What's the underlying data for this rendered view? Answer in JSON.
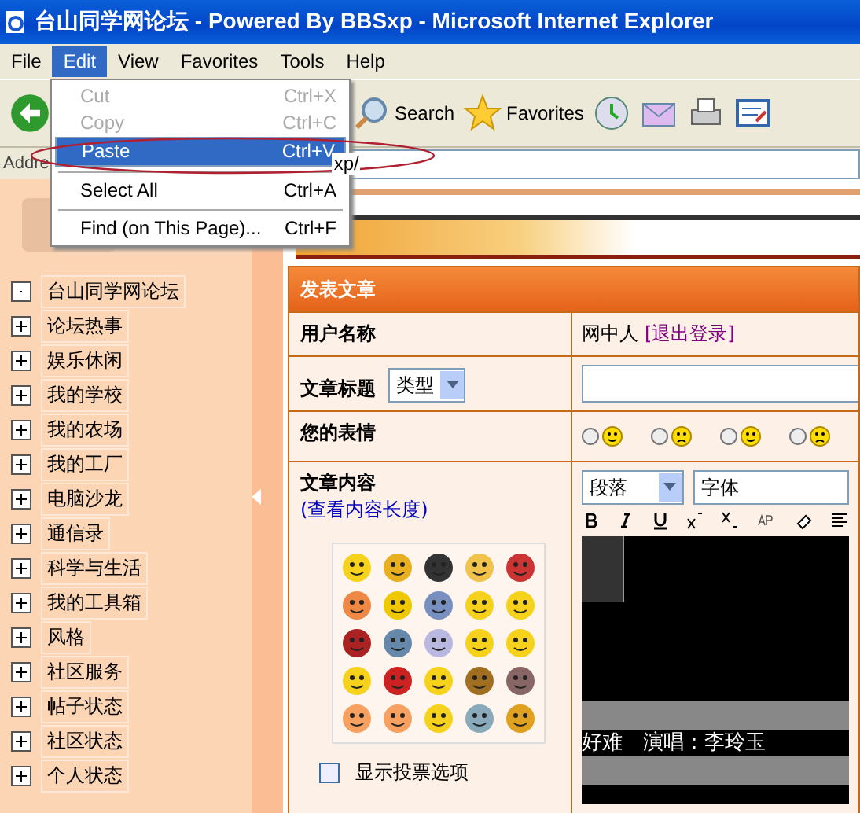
{
  "window": {
    "title": "台山同学网论坛 - Powered By BBSxp - Microsoft Internet Explorer"
  },
  "menu_bar": [
    {
      "label": "File",
      "selected": false
    },
    {
      "label": "Edit",
      "selected": true
    },
    {
      "label": "View",
      "selected": false
    },
    {
      "label": "Favorites",
      "selected": false
    },
    {
      "label": "Tools",
      "selected": false
    },
    {
      "label": "Help",
      "selected": false
    }
  ],
  "edit_menu": [
    {
      "kind": "item",
      "label": "Cut",
      "shortcut": "Ctrl+X",
      "disabled": true,
      "selected": false
    },
    {
      "kind": "item",
      "label": "Copy",
      "shortcut": "Ctrl+C",
      "disabled": true,
      "selected": false
    },
    {
      "kind": "item",
      "label": "Paste",
      "shortcut": "Ctrl+V",
      "disabled": false,
      "selected": true
    },
    {
      "kind": "separator"
    },
    {
      "kind": "item",
      "label": "Select All",
      "shortcut": "Ctrl+A",
      "disabled": false,
      "selected": false
    },
    {
      "kind": "separator"
    },
    {
      "kind": "item",
      "label": "Find (on This Page)...",
      "shortcut": "Ctrl+F",
      "disabled": false,
      "selected": false
    }
  ],
  "toolbar": {
    "search_label": "Search",
    "favorites_label": "Favorites"
  },
  "address_bar": {
    "label": "Addre",
    "value": "xp/"
  },
  "sidebar": {
    "items": [
      {
        "kind": "leaf",
        "label": "台山同学网论坛"
      },
      {
        "kind": "folder",
        "label": "论坛热事"
      },
      {
        "kind": "folder",
        "label": "娱乐休闲"
      },
      {
        "kind": "folder",
        "label": "我的学校"
      },
      {
        "kind": "folder",
        "label": "我的农场"
      },
      {
        "kind": "folder",
        "label": "我的工厂"
      },
      {
        "kind": "folder",
        "label": "电脑沙龙"
      },
      {
        "kind": "folder",
        "label": "通信录"
      },
      {
        "kind": "folder",
        "label": "科学与生活"
      },
      {
        "kind": "folder",
        "label": "我的工具箱"
      },
      {
        "kind": "folder",
        "label": "风格"
      },
      {
        "kind": "folder",
        "label": "社区服务"
      },
      {
        "kind": "folder",
        "label": "帖子状态"
      },
      {
        "kind": "folder",
        "label": "社区状态"
      },
      {
        "kind": "folder",
        "label": "个人状态"
      }
    ]
  },
  "post_form": {
    "title": "发表文章",
    "username_label": "用户名称",
    "username": "网中人",
    "logout_link": "[退出登录]",
    "subject_label": "文章标题",
    "type_select": "类型",
    "mood_label": "您的表情",
    "moods": [
      {
        "selected": false
      },
      {
        "selected": false
      },
      {
        "selected": false
      },
      {
        "selected": false
      }
    ],
    "content_label": "文章内容",
    "length_link": "(查看内容长度)",
    "poll_option": {
      "label": "显示投票选项",
      "checked": false
    },
    "editor": {
      "format_select": "段落",
      "font_select": "字体",
      "content_line": "好难　演唱：李玲玉"
    }
  }
}
